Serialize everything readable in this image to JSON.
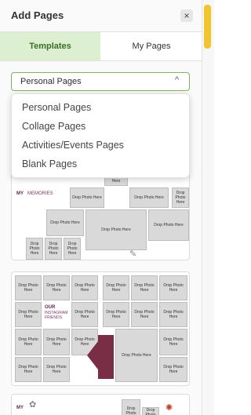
{
  "panel": {
    "title": "Add Pages",
    "close_label": "×"
  },
  "tabs": [
    {
      "label": "Templates",
      "active": true
    },
    {
      "label": "My Pages",
      "active": false
    }
  ],
  "select": {
    "value": "Personal Pages",
    "chevron": "^",
    "options": [
      "Personal Pages",
      "Collage Pages",
      "Activities/Events Pages",
      "Blank Pages"
    ]
  },
  "templates": {
    "card1": {
      "heading_prefix": "MY ",
      "heading_suffix": "MEMORIES",
      "cells": [
        "Drop Photo Here",
        "Drop Photo Here",
        "Drop Photo Here",
        "Drop Photo Here",
        "Drop Photo Here",
        "Drop Photo Here",
        "Drop Photo Here",
        "Drop Photo Here",
        "Drop Photo Here",
        "Drop Photo Here",
        "Drop Photo Here"
      ]
    },
    "card2": {
      "heading_our": "OUR",
      "heading_instagram": "INSTAGRAM",
      "heading_friends": "FRIENDS",
      "cells": [
        "Drop Photo Here",
        "Drop Photo Here",
        "Drop Photo Here",
        "Drop Photo Here",
        "Drop Photo Here",
        "Drop Photo Here",
        "Drop Photo Here",
        "Drop Photo Here",
        "Drop Photo Here",
        "Drop Photo Here",
        "Drop Photo Here",
        "Drop Photo Here",
        "Drop Photo Here",
        "Drop Photo Here",
        "Drop Photo Here",
        "Drop Photo Here",
        "Drop Photo Here",
        "Drop Photo Here",
        "Drop Photo Here"
      ]
    },
    "card3": {
      "heading": "MY",
      "cells": [
        "Drop Photo",
        "Drop Photo Here"
      ]
    }
  },
  "colors": {
    "accent": "#7fb35f",
    "active_tab_bg": "#dcefd0",
    "active_tab_text": "#3c6e2a",
    "scroll_thumb": "#f4c430",
    "brand_maroon": "#7a2e46"
  }
}
